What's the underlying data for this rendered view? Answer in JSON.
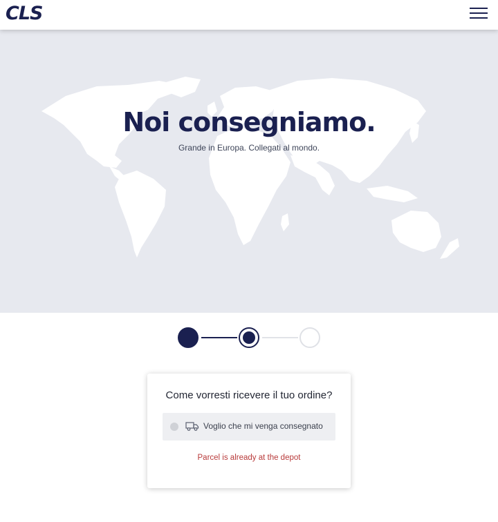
{
  "header": {
    "logo_text": "CLS",
    "menu_icon": "hamburger-menu-icon"
  },
  "hero": {
    "title": "Noi consegniamo.",
    "subtitle": "Grande in Europa. Collegati al mondo.",
    "background_color": "#e7e9ef",
    "map_color": "#ffffff"
  },
  "stepper": {
    "steps": [
      {
        "state": "completed"
      },
      {
        "state": "current"
      },
      {
        "state": "upcoming"
      }
    ],
    "active_color": "#1a2050"
  },
  "delivery_card": {
    "question": "Come vorresti ricevere il tuo ordine?",
    "option": {
      "icon": "truck-icon",
      "label": "Voglio che mi venga consegnato",
      "selected": false
    },
    "error_message": "Parcel is already at the depot",
    "error_color": "#b83a3a"
  }
}
